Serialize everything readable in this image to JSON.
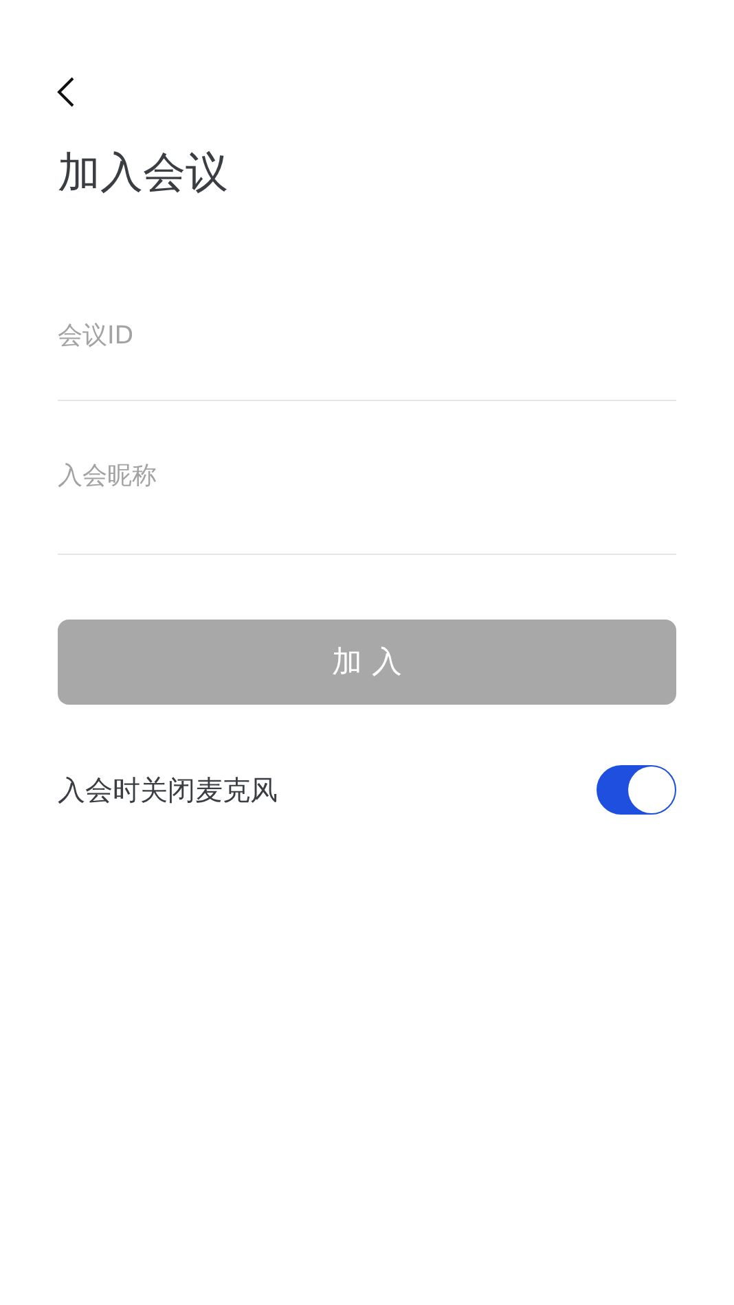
{
  "header": {
    "back": true,
    "title": "加入会议"
  },
  "fields": [
    {
      "placeholder": "会议ID"
    },
    {
      "placeholder": "入会昵称"
    }
  ],
  "join_button": {
    "label": "加 入",
    "disabled": true
  },
  "settings": [
    {
      "label": "入会时关闭麦克风",
      "on": true
    }
  ]
}
